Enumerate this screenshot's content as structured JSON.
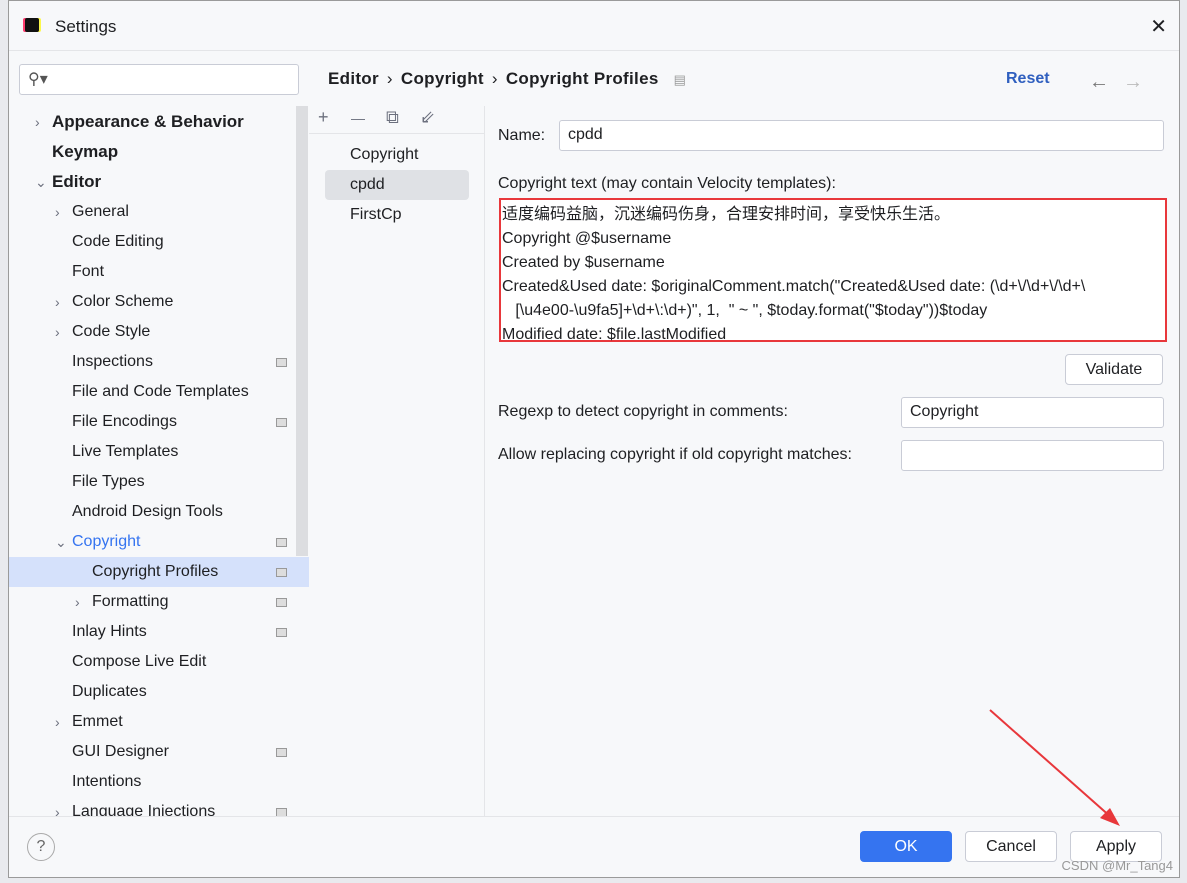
{
  "window": {
    "title": "Settings",
    "close": "✕"
  },
  "search": {
    "placeholder": "",
    "icon": "search-icon"
  },
  "breadcrumb": [
    "Editor",
    "Copyright",
    "Copyright Profiles"
  ],
  "breadcrumb_sep": "›",
  "reset": "Reset",
  "tree": [
    {
      "label": "Appearance & Behavior",
      "level": 0,
      "chevron": "›",
      "bold": true
    },
    {
      "label": "Keymap",
      "level": 0,
      "chevron": "",
      "bold": true
    },
    {
      "label": "Editor",
      "level": 0,
      "chevron": "⌄",
      "bold": true
    },
    {
      "label": "General",
      "level": 1,
      "chevron": "›"
    },
    {
      "label": "Code Editing",
      "level": 1,
      "chevron": ""
    },
    {
      "label": "Font",
      "level": 1,
      "chevron": ""
    },
    {
      "label": "Color Scheme",
      "level": 1,
      "chevron": "›"
    },
    {
      "label": "Code Style",
      "level": 1,
      "chevron": "›"
    },
    {
      "label": "Inspections",
      "level": 1,
      "chevron": "",
      "page": true
    },
    {
      "label": "File and Code Templates",
      "level": 1,
      "chevron": ""
    },
    {
      "label": "File Encodings",
      "level": 1,
      "chevron": "",
      "page": true
    },
    {
      "label": "Live Templates",
      "level": 1,
      "chevron": ""
    },
    {
      "label": "File Types",
      "level": 1,
      "chevron": ""
    },
    {
      "label": "Android Design Tools",
      "level": 1,
      "chevron": ""
    },
    {
      "label": "Copyright",
      "level": 1,
      "chevron": "⌄",
      "page": true,
      "active": true
    },
    {
      "label": "Copyright Profiles",
      "level": 2,
      "chevron": "",
      "page": true,
      "selected": true
    },
    {
      "label": "Formatting",
      "level": 2,
      "chevron": "›",
      "page": true
    },
    {
      "label": "Inlay Hints",
      "level": 1,
      "chevron": "",
      "page": true
    },
    {
      "label": "Compose Live Edit",
      "level": 1,
      "chevron": ""
    },
    {
      "label": "Duplicates",
      "level": 1,
      "chevron": ""
    },
    {
      "label": "Emmet",
      "level": 1,
      "chevron": "›"
    },
    {
      "label": "GUI Designer",
      "level": 1,
      "chevron": "",
      "page": true
    },
    {
      "label": "Intentions",
      "level": 1,
      "chevron": ""
    },
    {
      "label": "Language Injections",
      "level": 1,
      "chevron": "›",
      "page": true
    }
  ],
  "profiles": {
    "toolbar": {
      "add": "+",
      "remove": "—",
      "copy": "⧉",
      "import": "⇙"
    },
    "items": [
      "Copyright",
      "cpdd",
      "FirstCp"
    ],
    "selected": 1
  },
  "form": {
    "name_label": "Name:",
    "name_value": "cpdd",
    "text_label": "Copyright text (may contain Velocity templates):",
    "text_lines": [
      "适度编码益脑，沉迷编码伤身，合理安排时间，享受快乐生活。",
      "Copyright @$username",
      "Created by $username",
      "Created&Used date: $originalComment.match(\"Created&Used date: (\\d+\\/\\d+\\/\\d+\\",
      "   [\\u4e00-\\u9fa5]+\\d+\\:\\d+)\", 1,  \" ~ \", $today.format(\"$today\"))$today",
      "Modified date: $file.lastModified"
    ],
    "validate": "Validate",
    "regexp_label": "Regexp to detect copyright in comments:",
    "regexp_value": "Copyright",
    "allow_label": "Allow replacing copyright if old copyright matches:",
    "allow_value": ""
  },
  "footer": {
    "help": "?",
    "ok": "OK",
    "cancel": "Cancel",
    "apply": "Apply"
  },
  "watermark": "CSDN @Mr_Tang4",
  "colors": {
    "accent": "#3574f0",
    "highlight": "#e8373b",
    "selected": "#d5e1fb"
  }
}
